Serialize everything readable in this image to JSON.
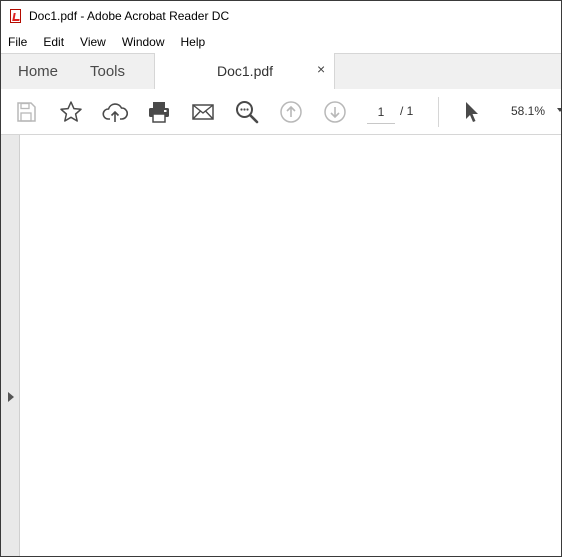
{
  "window": {
    "title": "Doc1.pdf - Adobe Acrobat Reader DC"
  },
  "menu": [
    "File",
    "Edit",
    "View",
    "Window",
    "Help"
  ],
  "tabs": {
    "home": "Home",
    "tools": "Tools",
    "document": "Doc1.pdf",
    "close": "×"
  },
  "toolbar": {
    "icons": [
      "save-icon",
      "bookmark-star-icon",
      "upload-cloud-icon",
      "print-icon",
      "email-icon",
      "zoom-search-icon",
      "page-up-icon",
      "page-down-icon",
      "select-cursor-icon"
    ],
    "page_current": "1",
    "page_total": "/ 1",
    "zoom": "58.1%"
  },
  "colors": {
    "accent": "#b30b00",
    "icon": "#4a4a4a",
    "icon_disabled": "#b8b8b8",
    "tab_bg": "#f0f0f0"
  }
}
